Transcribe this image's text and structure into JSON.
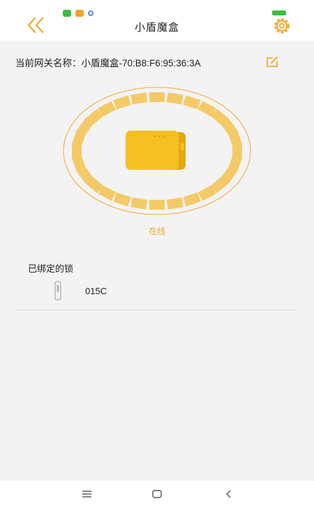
{
  "header": {
    "title": "小盾魔盒",
    "battery_text": "100"
  },
  "gateway": {
    "label": "当前网关名称：小盾魔盒-70:B8:F6:95:36:3A"
  },
  "device": {
    "status": "在线"
  },
  "locks": {
    "section_title": "已绑定的锁",
    "items": [
      {
        "name": "015C"
      }
    ]
  },
  "colors": {
    "accent": "#f0a830",
    "ring_segment": "#f4ca68",
    "box_fill": "#f5bf22"
  },
  "icons": {
    "back": "double-chevron-left-icon",
    "settings": "gear-icon",
    "edit": "edit-icon",
    "lock": "door-lock-icon",
    "menu": "menu-icon",
    "home": "home-icon",
    "navigate_back": "back-arrow-icon"
  }
}
